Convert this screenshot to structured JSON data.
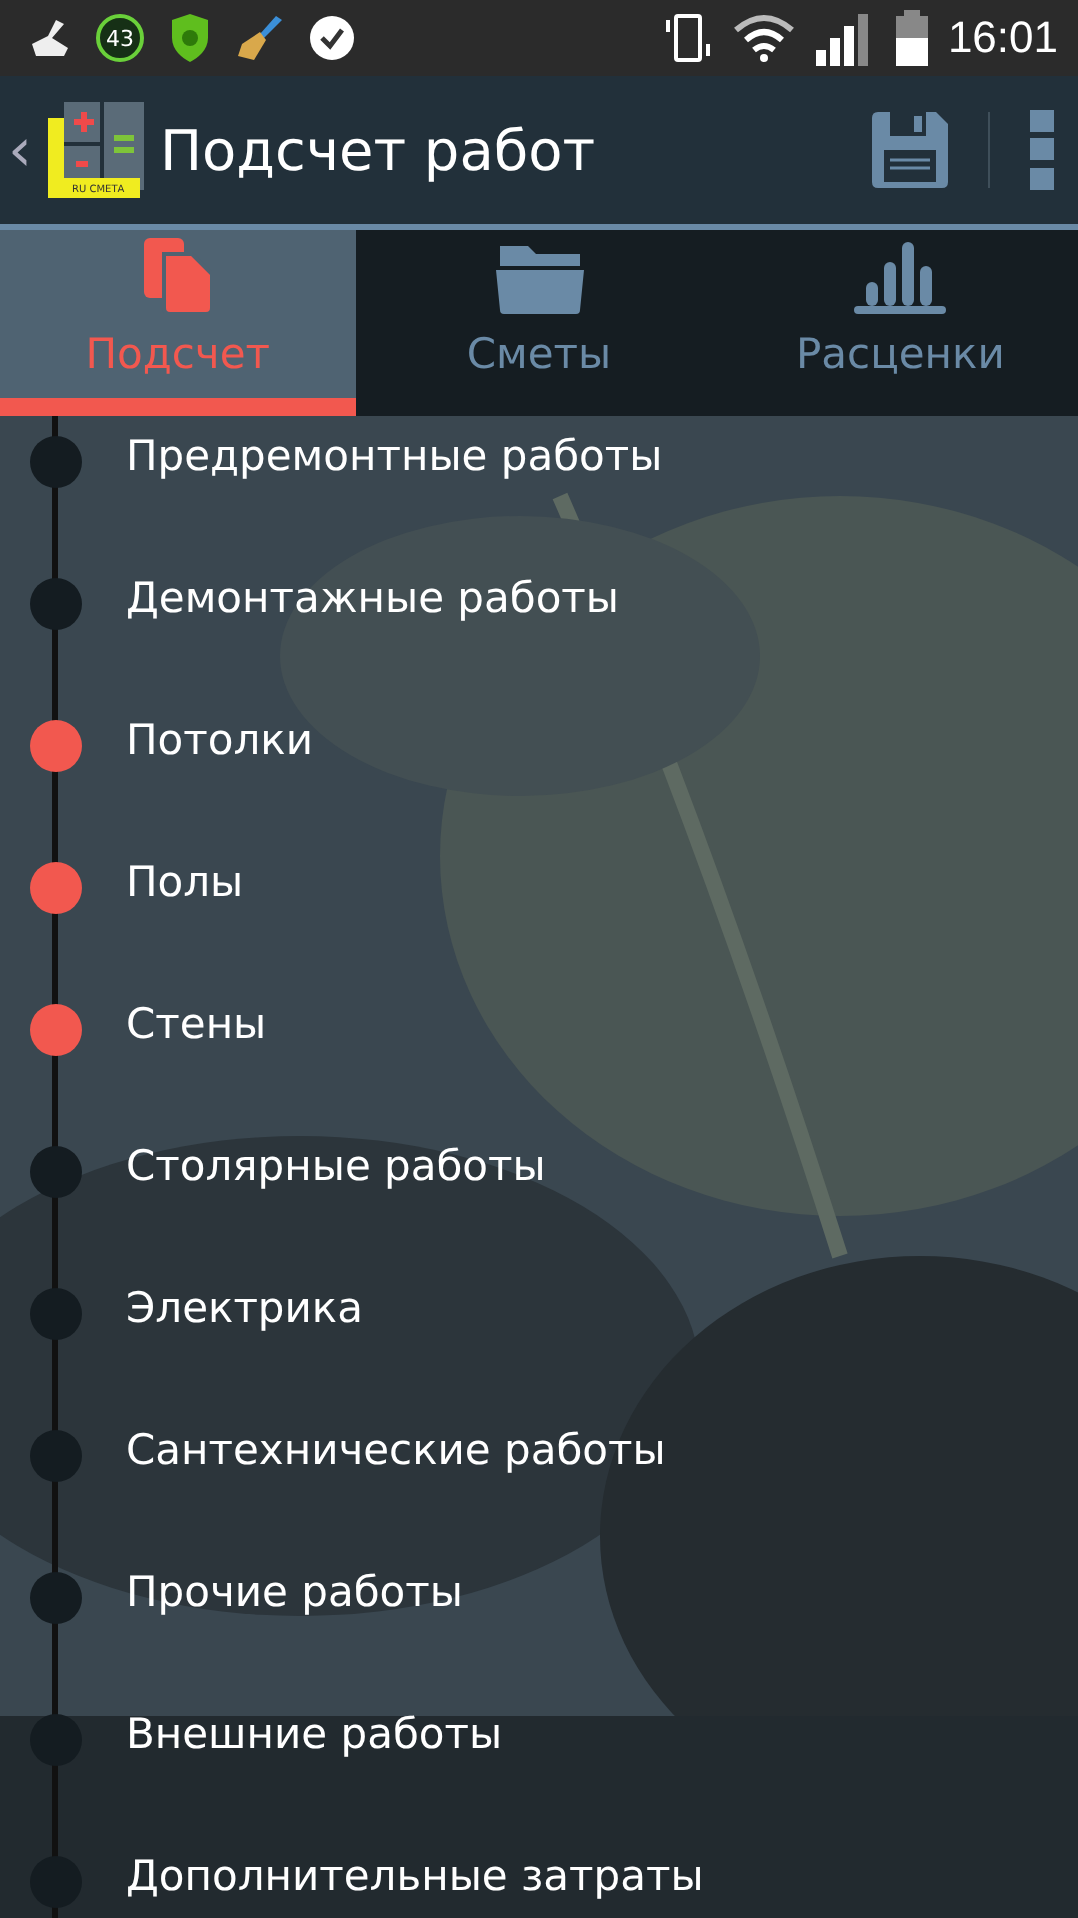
{
  "status_bar": {
    "badge": "43",
    "time": "16:01"
  },
  "app_bar": {
    "back": "‹",
    "logo_text": "RU СМЕТА",
    "title": "Подсчет работ"
  },
  "tabs": [
    {
      "label": "Подсчет",
      "kind": "copy",
      "selected": true
    },
    {
      "label": "Сметы",
      "kind": "folder",
      "selected": false
    },
    {
      "label": "Расценки",
      "kind": "bars",
      "selected": false
    }
  ],
  "items": [
    {
      "label": "Предремонтные работы",
      "done": false
    },
    {
      "label": "Демонтажные работы",
      "done": false
    },
    {
      "label": "Потолки",
      "done": true
    },
    {
      "label": "Полы",
      "done": true
    },
    {
      "label": "Стены",
      "done": true
    },
    {
      "label": "Столярные работы",
      "done": false
    },
    {
      "label": "Электрика",
      "done": false
    },
    {
      "label": "Сантехнические работы",
      "done": false
    },
    {
      "label": "Прочие работы",
      "done": false
    },
    {
      "label": "Внешние работы",
      "done": false
    },
    {
      "label": "Дополнительные затраты",
      "done": false
    }
  ]
}
